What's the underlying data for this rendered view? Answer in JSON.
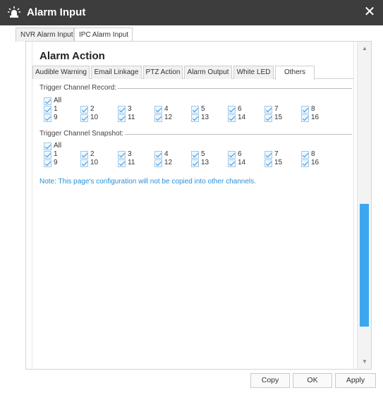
{
  "window": {
    "title": "Alarm Input",
    "close_glyph": "✕",
    "title_bg": "#3d3d3d"
  },
  "outer_tabs": [
    {
      "label": "NVR Alarm Input",
      "active": false
    },
    {
      "label": "IPC Alarm Input",
      "active": true
    }
  ],
  "section_title": "Alarm Action",
  "inner_tabs": [
    {
      "label": "Audible Warning",
      "active": false
    },
    {
      "label": "Email Linkage",
      "active": false
    },
    {
      "label": "PTZ Action",
      "active": false
    },
    {
      "label": "Alarm Output",
      "active": false
    },
    {
      "label": "White LED",
      "active": false
    },
    {
      "label": "Others",
      "active": true
    }
  ],
  "record_group": {
    "label": "Trigger Channel Record:",
    "all_label": "All",
    "channels": [
      "1",
      "2",
      "3",
      "4",
      "5",
      "6",
      "7",
      "8",
      "9",
      "10",
      "11",
      "12",
      "13",
      "14",
      "15",
      "16"
    ]
  },
  "snapshot_group": {
    "label": "Trigger Channel Snapshot:",
    "all_label": "All",
    "channels": [
      "1",
      "2",
      "3",
      "4",
      "5",
      "6",
      "7",
      "8",
      "9",
      "10",
      "11",
      "12",
      "13",
      "14",
      "15",
      "16"
    ]
  },
  "note": "Note: This page's configuration will not be copied into other channels.",
  "buttons": {
    "copy": "Copy",
    "ok": "OK",
    "apply": "Apply"
  },
  "colors": {
    "accent": "#3da7ee",
    "note": "#2a8fd6"
  },
  "icons": {
    "window": "alarm-light-icon",
    "close": "close-icon",
    "scroll_up": "triangle-up-icon",
    "scroll_down": "triangle-down-icon"
  }
}
